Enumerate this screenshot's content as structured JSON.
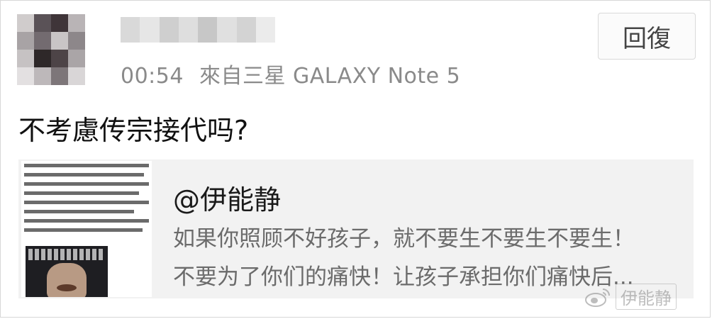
{
  "post": {
    "timestamp": "00:54",
    "source": "來自三星 GALAXY Note 5",
    "reply_label": "回復",
    "text": "不考慮传宗接代吗?"
  },
  "shared_card": {
    "author": "@伊能静",
    "line1": "如果你照顾不好孩子，就不要生不要生不要生！",
    "line2": "不要为了你们的痛快！让孩子承担你们痛快后..."
  },
  "watermark": {
    "text": "伊能静"
  },
  "avatar": {
    "colors": [
      "#d0cccc",
      "#5a5257",
      "#3f3539",
      "#b9b4b6",
      "#a8a3a5",
      "#736b70",
      "#c9c5c6",
      "#8d878a",
      "#c6c2c3",
      "#2e2829",
      "#4d4447",
      "#aaa5a7",
      "#e3e0e1",
      "#bdb8ba",
      "#7d7679",
      "#d9d6d7"
    ]
  },
  "username_blur": {
    "colors": [
      "#d9d9d9",
      "#e6e6e6",
      "#cfcfcf",
      "#dedede",
      "#c7c7c7",
      "#e0e0e0",
      "#d3d3d3",
      "#ebebeb"
    ]
  }
}
